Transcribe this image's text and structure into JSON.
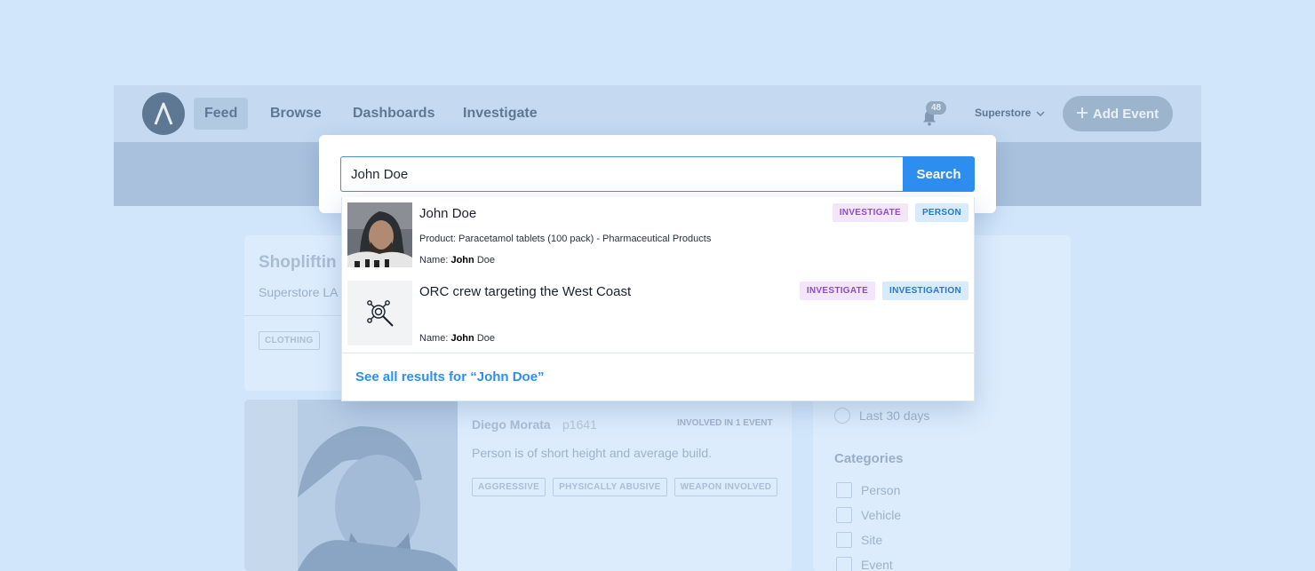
{
  "nav": {
    "items": [
      {
        "label": "Feed",
        "active": true
      },
      {
        "label": "Browse",
        "active": false
      },
      {
        "label": "Dashboards",
        "active": false
      },
      {
        "label": "Investigate",
        "active": false
      }
    ],
    "notifications_count": "48",
    "store": "Superstore",
    "add_event": "Add Event",
    "icons": {
      "logo": "lambda-logo-icon",
      "bell": "bell-icon",
      "chevron": "chevron-down-icon",
      "plus": "plus-icon"
    }
  },
  "background": {
    "card1": {
      "title": "Shopliftin",
      "subtitle": "Superstore LA",
      "tag": "CLOTHING"
    },
    "card2": {
      "name": "Diego Morata",
      "id": "p1641",
      "involved": "INVOLVED IN 1 EVENT",
      "description": "Person is of short height and average build.",
      "tags": [
        "AGGRESSIVE",
        "PHYSICALLY ABUSIVE",
        "WEAPON INVOLVED"
      ]
    },
    "filters": {
      "date_option": "Last 30 days",
      "categories_title": "Categories",
      "categories": [
        "Person",
        "Vehicle",
        "Site",
        "Event"
      ]
    }
  },
  "search": {
    "value": "John Doe",
    "button": "Search",
    "results": [
      {
        "title": "John Doe",
        "line1": "Product: Paracetamol tablets (100 pack) - Pharmaceutical Products",
        "name_label": "Name:",
        "name_bold": "John",
        "name_rest": "Doe",
        "badges": [
          "INVESTIGATE",
          "PERSON"
        ]
      },
      {
        "title": "ORC crew targeting the West Coast",
        "name_label": "Name:",
        "name_bold": "John",
        "name_rest": "Doe",
        "badges": [
          "INVESTIGATE",
          "INVESTIGATION"
        ],
        "icon": "network-search-icon"
      }
    ],
    "see_all": "See all results for “John Doe”"
  },
  "colors": {
    "background": "#d2e6fb",
    "accent": "#2e8ef0",
    "badge_investigate": "#8b4fc4",
    "badge_type": "#2a77c7"
  }
}
